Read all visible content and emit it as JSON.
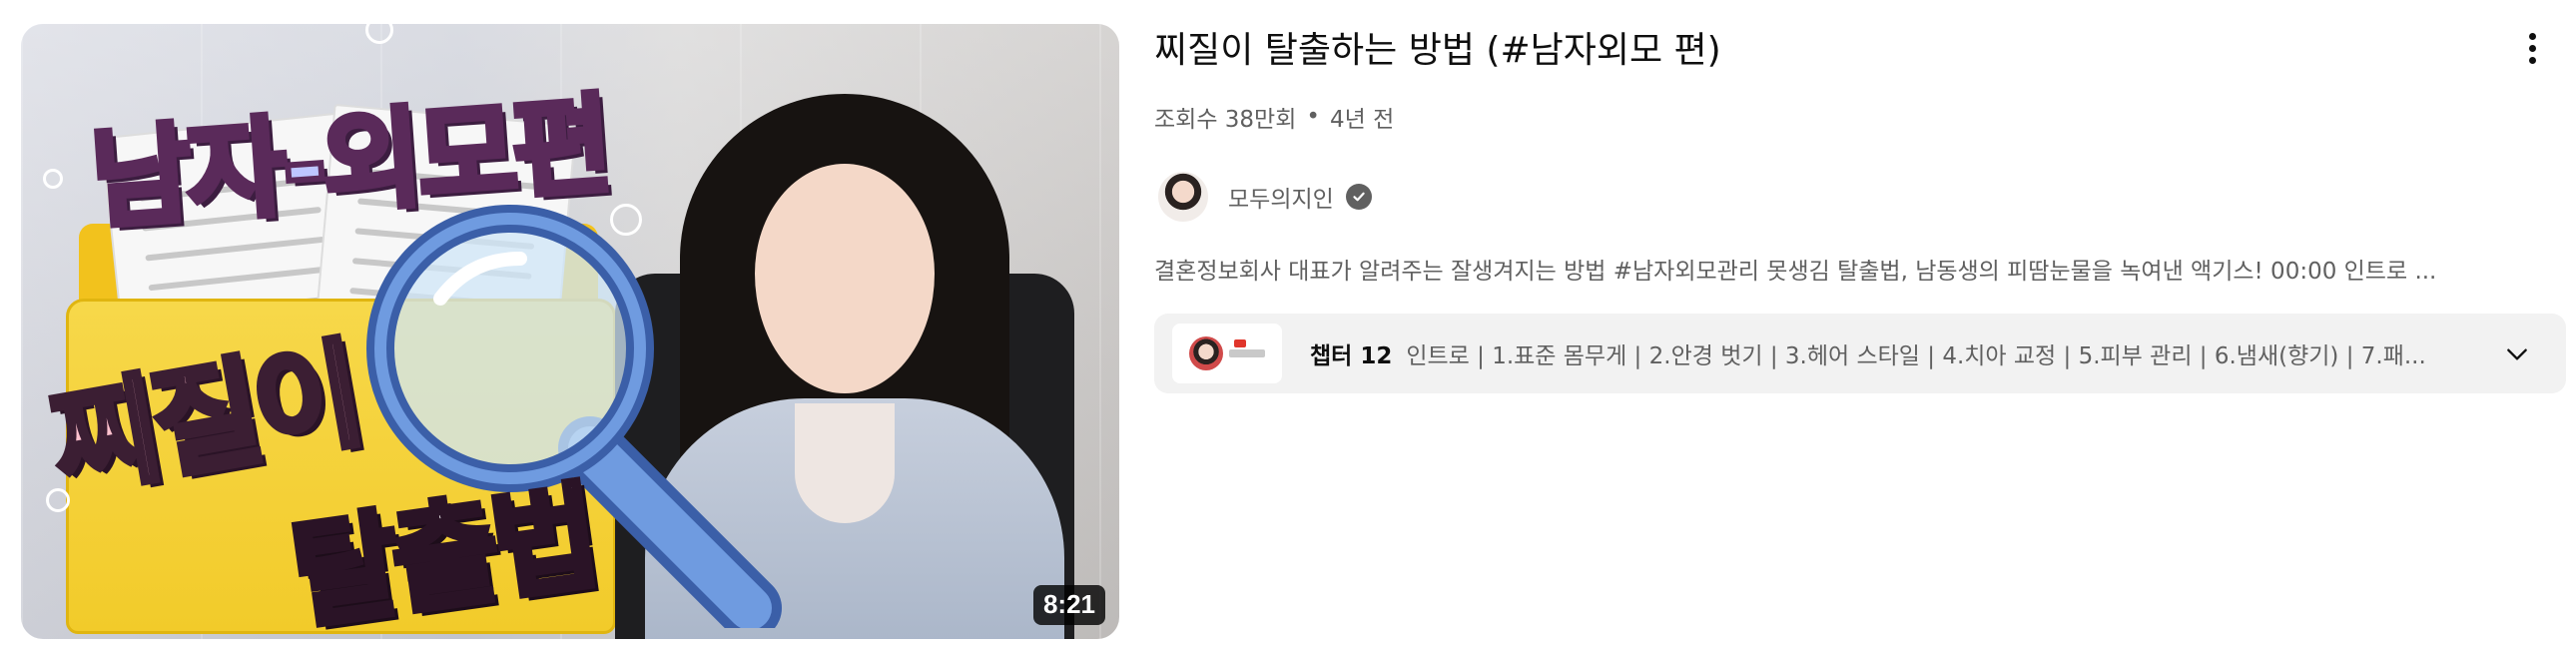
{
  "video": {
    "title": "찌질이 탈출하는 방법 (#남자외모 편)",
    "views": "조회수 38만회",
    "separator": "•",
    "age": "4년 전",
    "duration": "8:21",
    "description": "결혼정보회사 대표가 알려주는 잘생겨지는 방법 #남자외모관리 못생김 탈출법, 남동생의 피땀눈물을 녹여낸 액기스! 00:00 인트로 ..."
  },
  "thumbnail": {
    "text_top": "남자-외모편",
    "text_big": "찌질이",
    "text_sub": "탈출법"
  },
  "channel": {
    "name": "모두의지인",
    "verified": true
  },
  "chapters": {
    "label": "챕터 12",
    "summary": "인트로 | 1.표준 몸무게 | 2.안경 벗기 | 3.헤어 스타일 | 4.치아 교정 | 5.피부 관리 | 6.냄새(향기) | 7.패..."
  },
  "icons": {
    "more": "more-vert-icon",
    "verified": "check-badge-icon",
    "expand": "chevron-down-icon"
  },
  "colors": {
    "text_primary": "#0f0f0f",
    "text_secondary": "#606060",
    "chapter_bg": "#f2f2f2"
  }
}
